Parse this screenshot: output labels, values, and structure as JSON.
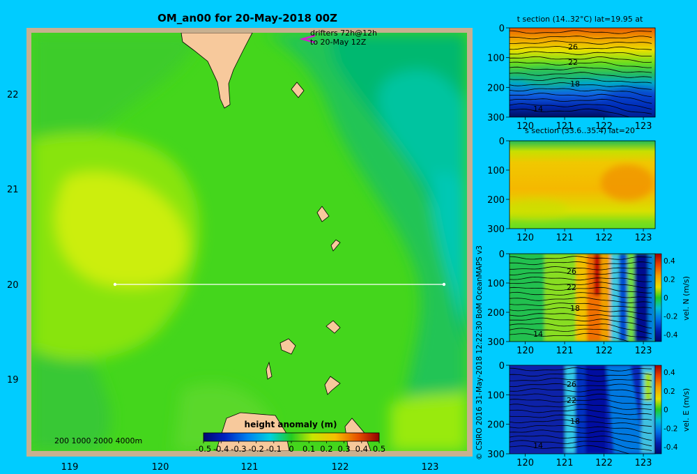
{
  "title": "OM_an00 for 20-May-2018 00Z",
  "drifters": {
    "line1": "drifters 72h@12h",
    "line2": "to 20-May 12Z"
  },
  "credit": "© CSIRO 2016  31-May-2018 12:22:30 BoM OceanMAPS v3",
  "map": {
    "x_ticks": [
      "119",
      "120",
      "121",
      "122",
      "123"
    ],
    "y_ticks": [
      "22",
      "21",
      "20",
      "19"
    ],
    "depth_legend": "200  1000  2000  4000m",
    "section_line": {
      "lon": [
        119.5,
        123.2
      ],
      "lat": 20
    },
    "colorbar": {
      "title": "height anomaly  (m)",
      "ticks": [
        "-0.5",
        "-0.4",
        "-0.3",
        "-0.2",
        "-0.1",
        "0",
        "0.1",
        "0.2",
        "0.3",
        "0.4",
        "0.5"
      ]
    }
  },
  "panels": {
    "t": {
      "title": "t section (14..32°C) lat=19.95 at"
    },
    "s": {
      "title": "s section (33.6..35.4) lat=20"
    },
    "vn": {
      "cb_label": "vel. N (m/s)"
    },
    "ve": {
      "cb_label": "vel. E (m/s)"
    },
    "y_ticks": [
      "0",
      "100",
      "200",
      "300"
    ],
    "x_ticks": [
      "120",
      "121",
      "122",
      "123"
    ],
    "cb_ticks": [
      "0.4",
      "0.2",
      "0",
      "-0.2",
      "-0.4"
    ],
    "contour_labels": [
      "26",
      "22",
      "18",
      "14"
    ]
  },
  "chart_data": [
    {
      "type": "heatmap",
      "title": "OM_an00 for 20-May-2018 00Z",
      "xlim": [
        118.5,
        123.5
      ],
      "ylim": [
        18.2,
        22.7
      ],
      "colorbar_range": [
        -0.5,
        0.5
      ],
      "colorbar_title": "height anomaly  (m)"
    },
    {
      "type": "heatmap",
      "title": "t section (14..32°C) lat=19.95 at",
      "xlim": [
        119.6,
        123.3
      ],
      "ylim": [
        300,
        0
      ],
      "contours": [
        26,
        22,
        18,
        14
      ]
    },
    {
      "type": "heatmap",
      "title": "s section (33.6..35.4) lat=20",
      "xlim": [
        119.6,
        123.3
      ],
      "ylim": [
        300,
        0
      ]
    },
    {
      "type": "heatmap",
      "xlim": [
        119.6,
        123.3
      ],
      "ylim": [
        300,
        0
      ],
      "colorbar_range": [
        -0.4,
        0.4
      ],
      "colorbar_label": "vel. N (m/s)"
    },
    {
      "type": "heatmap",
      "xlim": [
        119.6,
        123.3
      ],
      "ylim": [
        300,
        0
      ],
      "colorbar_range": [
        -0.4,
        0.4
      ],
      "colorbar_label": "vel. E (m/s)"
    }
  ]
}
